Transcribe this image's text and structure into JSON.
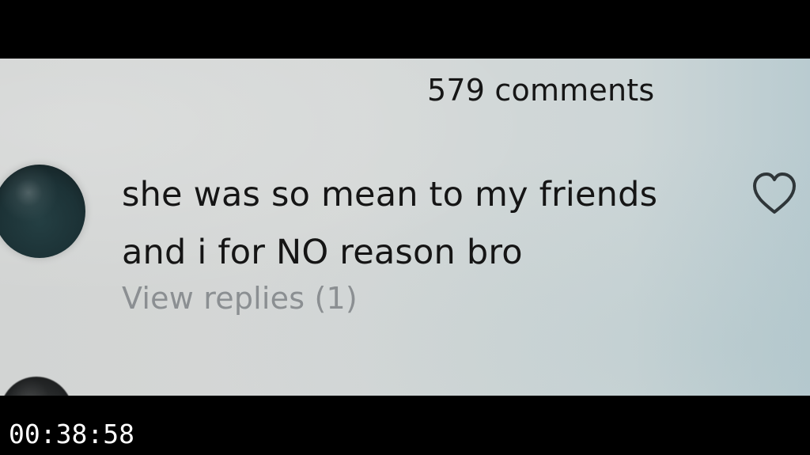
{
  "header": {
    "comments_count": "579 comments"
  },
  "comment": {
    "text_lines": [
      "she was so mean to my friends",
      "and i for NO reason bro"
    ],
    "replies_label": "View replies (1)"
  },
  "overlay": {
    "timestamp": "00:38:58"
  },
  "icons": {
    "like": "heart-outline-icon"
  },
  "colors": {
    "background": "#d4d7d6",
    "text": "#151515",
    "secondary_text": "#8b8f92",
    "avatar": "#1c3236",
    "letterbox": "#000000"
  }
}
